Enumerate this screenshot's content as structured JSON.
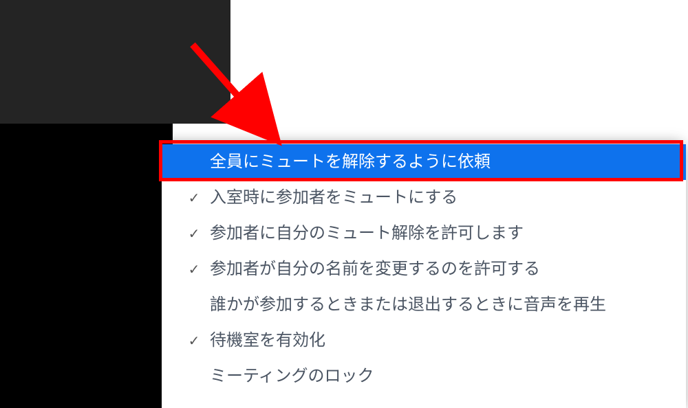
{
  "menu": {
    "items": [
      {
        "label": "全員にミュートを解除するように依頼",
        "checked": false
      },
      {
        "label": "入室時に参加者をミュートにする",
        "checked": true
      },
      {
        "label": "参加者に自分のミュート解除を許可します",
        "checked": true
      },
      {
        "label": "参加者が自分の名前を変更するのを許可する",
        "checked": true
      },
      {
        "label": "誰かが参加するときまたは退出するときに音声を再生",
        "checked": false
      },
      {
        "label": "待機室を有効化",
        "checked": true
      },
      {
        "label": "ミーティングのロック",
        "checked": false
      }
    ]
  },
  "annotation": {
    "arrow_color": "#ff0000",
    "box_color": "#ff0000"
  }
}
